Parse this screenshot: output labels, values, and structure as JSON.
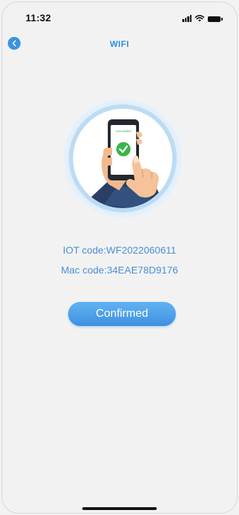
{
  "status_bar": {
    "time": "11:32"
  },
  "nav": {
    "title": "WIFI"
  },
  "illustration": {
    "phone_screen_text": "succeeded"
  },
  "info": {
    "iot_code": "IOT code:WF2022060611",
    "mac_code": "Mac code:34EAE78D9176"
  },
  "actions": {
    "confirm_label": "Confirmed"
  },
  "colors": {
    "accent": "#3b93e4",
    "title": "#2e8fe2",
    "info_text": "#4a8fd4",
    "background": "#f2f2f3"
  }
}
